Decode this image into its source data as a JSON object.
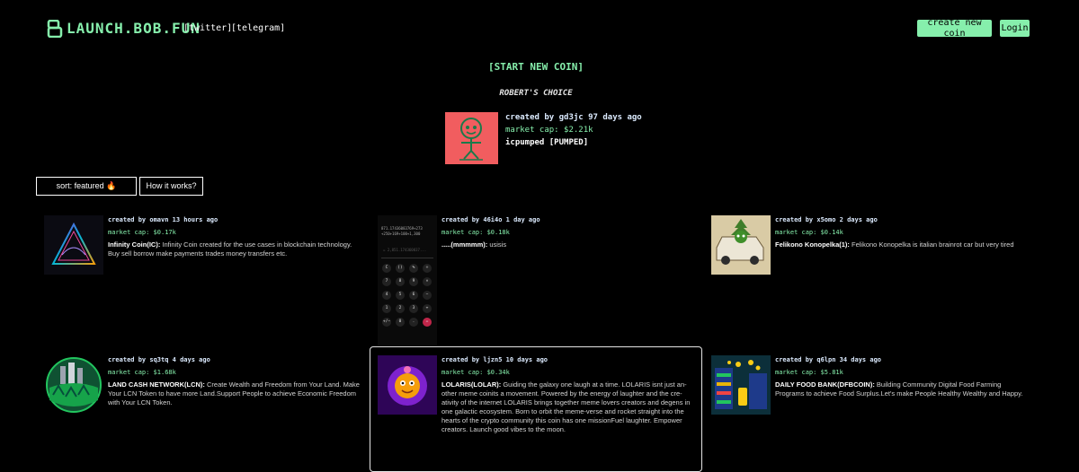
{
  "header": {
    "logo_text": "LAUNCH.BOB.FUN",
    "nav": [
      "[twitter]",
      "[telegram]"
    ],
    "create_button": "create new coin",
    "login_button": "Login"
  },
  "start_new_coin": "[START NEW COIN]",
  "roberts_choice": {
    "title": "ROBERT'S CHOICE",
    "created": "created by gd3jc 97 days ago",
    "market_cap": "market cap: $2.21k",
    "name": "icpumped [PUMPED]"
  },
  "controls": {
    "sort": "sort: featured 🔥",
    "how": "How it works?"
  },
  "calculator": {
    "time": "",
    "display_line1": "871.17436083769+273",
    "display_line2": "+250+169+100+1,300",
    "result": "= 2,851.174360837...",
    "keys": [
      [
        "C",
        "()",
        "%",
        "÷"
      ],
      [
        "7",
        "8",
        "9",
        "×"
      ],
      [
        "4",
        "5",
        "6",
        "−"
      ],
      [
        "1",
        "2",
        "3",
        "+"
      ],
      [
        "+/−",
        "0",
        ".",
        "="
      ]
    ]
  },
  "coins": [
    {
      "created": "created by omavn 13 hours ago",
      "market_cap": "market cap: $0.17k",
      "name": "Infinity Coin(IC):",
      "description": " Infinity Coin created for the use cases in blockchain technology. Buy sell borrow make payments trades money transfers etc."
    },
    {
      "created": "created by 46i4o 1 day ago",
      "market_cap": "market cap: $0.18k",
      "name": ".....(mmmmm):",
      "description": " usisis"
    },
    {
      "created": "created by x5omo 2 days ago",
      "market_cap": "market cap: $0.14k",
      "name": "Felikono Konopelka(1):",
      "description": " Felikono Konopelka is italian brainrot car but very tired"
    },
    {
      "created": "created by sq3tq 4 days ago",
      "market_cap": "market cap: $1.68k",
      "name": "LAND CASH NETWORK(LCN):",
      "description": " Create Wealth and Freedom from Your Land. Make Your LCN Token to have more Land.Support People to achieve Economic Freedom with Your LCN Token."
    },
    {
      "created": "created by ljzn5 10 days ago",
      "market_cap": "market cap: $0.34k",
      "name": "LOLARIS(LOLAR):",
      "description": " Guiding the galaxy one laugh at a time. LOLARIS isnt just an-other meme coinits a movement. Powered by the energy of laughter and the cre-ativity of the internet LOLARIS brings together meme lovers creators and degens in one galactic ecosystem. Born to orbit the meme-verse and rocket straight into the hearts of the crypto community this coin has one missionFuel laughter. Empower creators. Launch good vibes to the moon."
    },
    {
      "created": "created by q6lpn 34 days ago",
      "market_cap": "market cap: $5.81k",
      "name": "DAILY FOOD BANK(DFBCOIN):",
      "description": " Building Community Digital Food Farming Programs to achieve Food Surplus.Let's make People Healthy Wealthy and Happy."
    }
  ],
  "colors": {
    "accent": "#86efac",
    "background": "#000000",
    "featured_bg": "#f15d5f"
  }
}
